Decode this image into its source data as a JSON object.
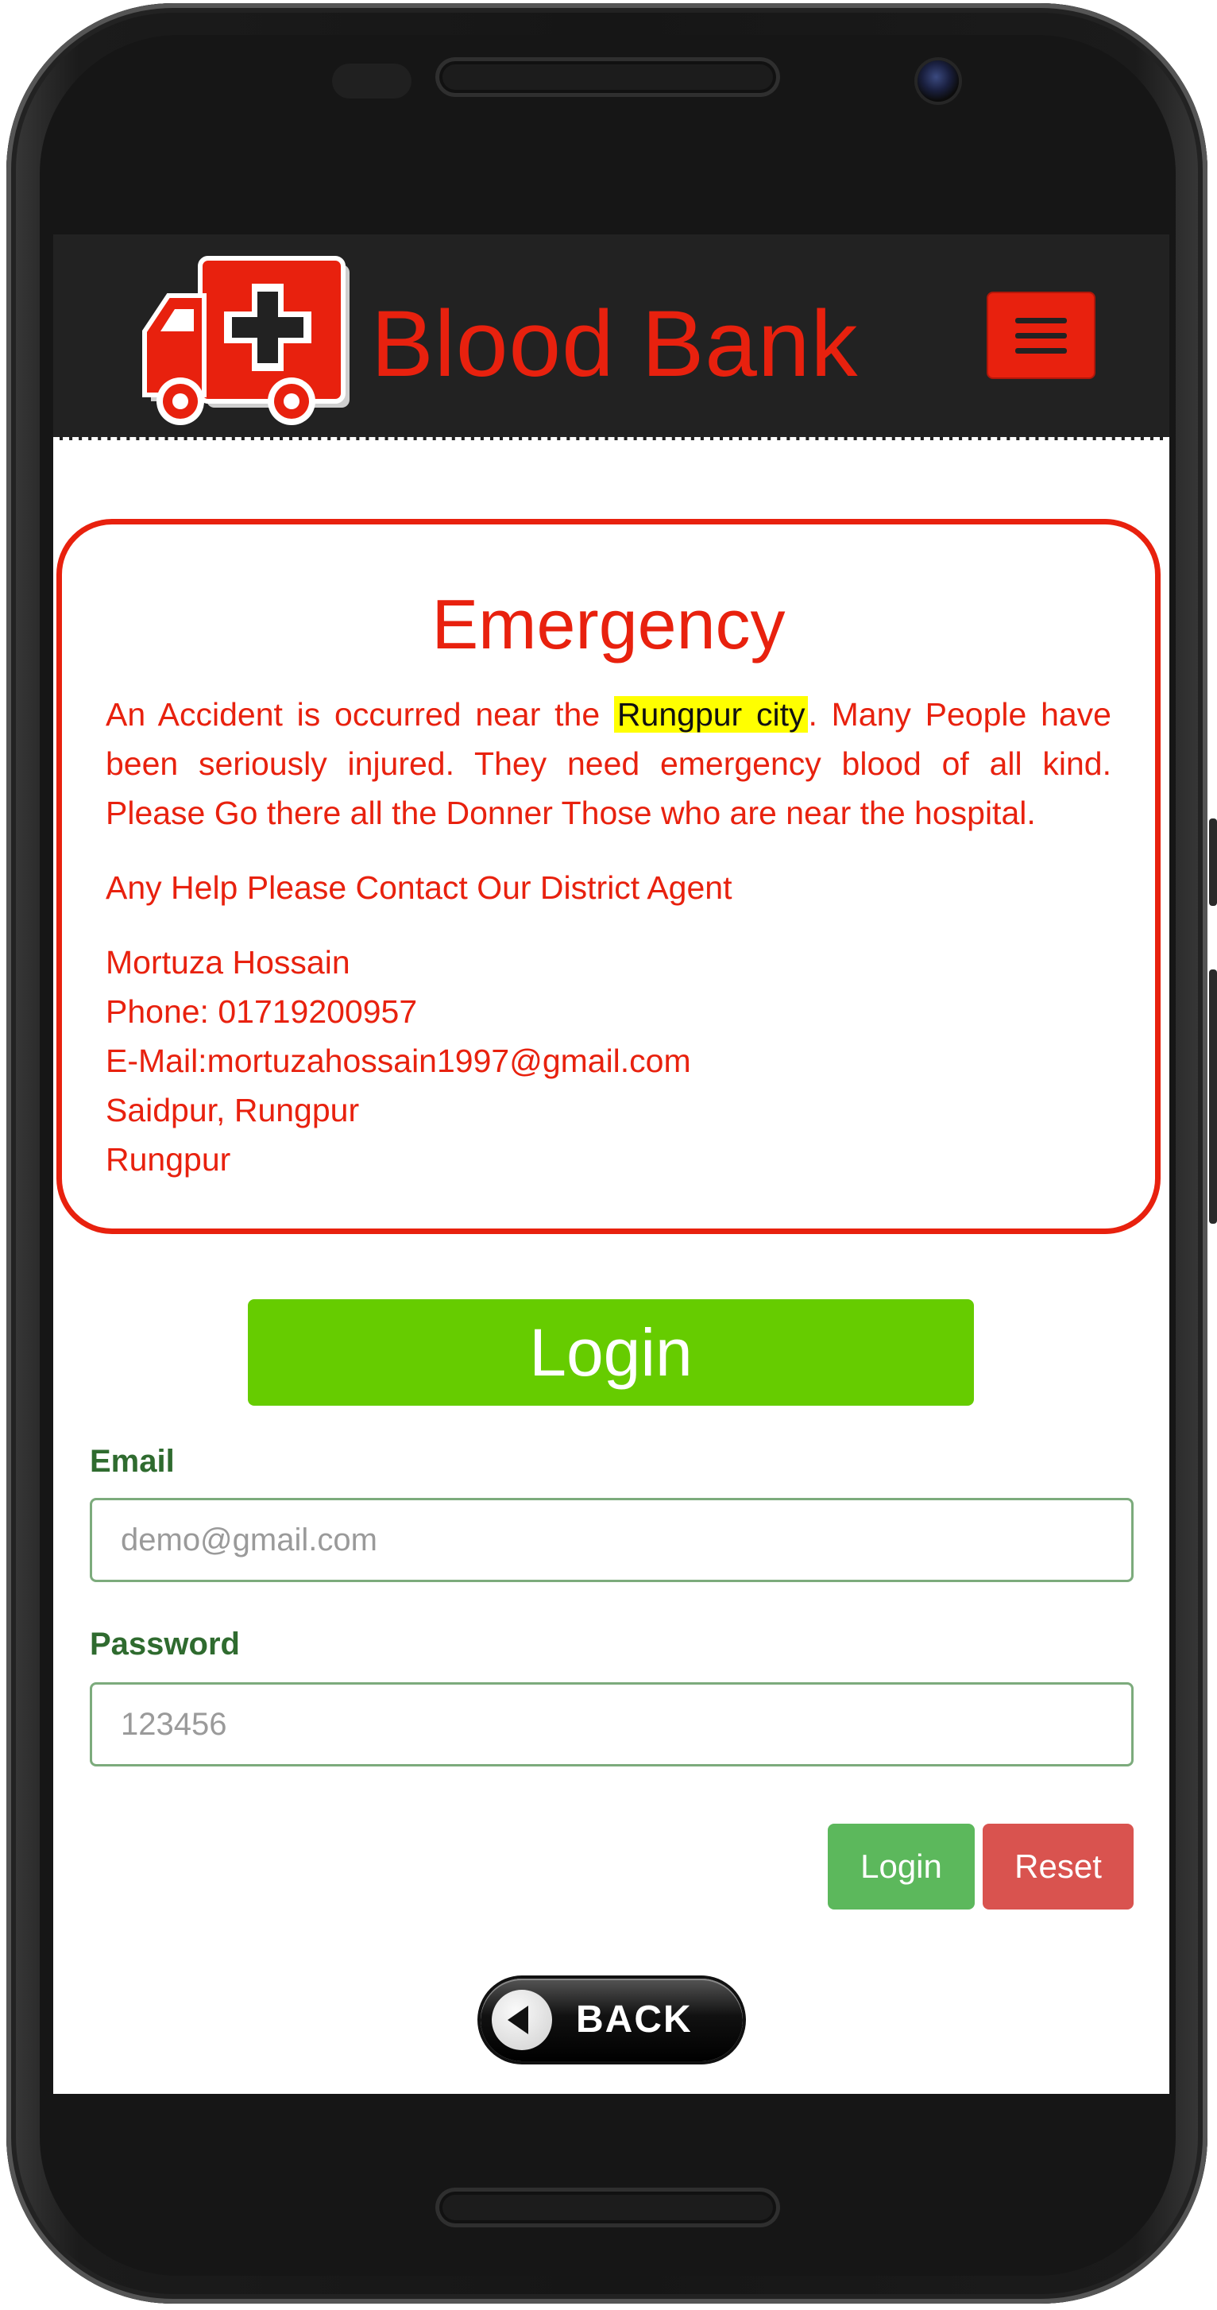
{
  "header": {
    "brand": "Blood Bank",
    "logo_icon": "ambulance-icon",
    "menu_icon": "hamburger-menu-icon"
  },
  "emergency": {
    "title": "Emergency",
    "message_before": "An Accident is occurred near the",
    "highlight": "Rungpur city",
    "message_after": ". Many People have been seriously injured. They need emergency blood of all kind. Please Go there all the Donner Those who are near the hospital.",
    "contact_prompt": "Any Help Please Contact Our District Agent",
    "agent": {
      "name": "Mortuza Hossain",
      "phone": "Phone: 01719200957",
      "email": "E-Mail:mortuzahossain1997@gmail.com",
      "address": "Saidpur, Rungpur",
      "district": "Rungpur"
    }
  },
  "login_form": {
    "banner": "Login",
    "email_label": "Email",
    "email_placeholder": "demo@gmail.com",
    "password_label": "Password",
    "password_placeholder": "123456",
    "login_button": "Login",
    "reset_button": "Reset"
  },
  "back_button": "BACK",
  "colors": {
    "brand_red": "#e8210e",
    "header_bg": "#222222",
    "banner_green": "#66cc00",
    "login_green": "#5cb85c",
    "reset_red": "#d9534f",
    "highlight_yellow": "#ffff00"
  }
}
